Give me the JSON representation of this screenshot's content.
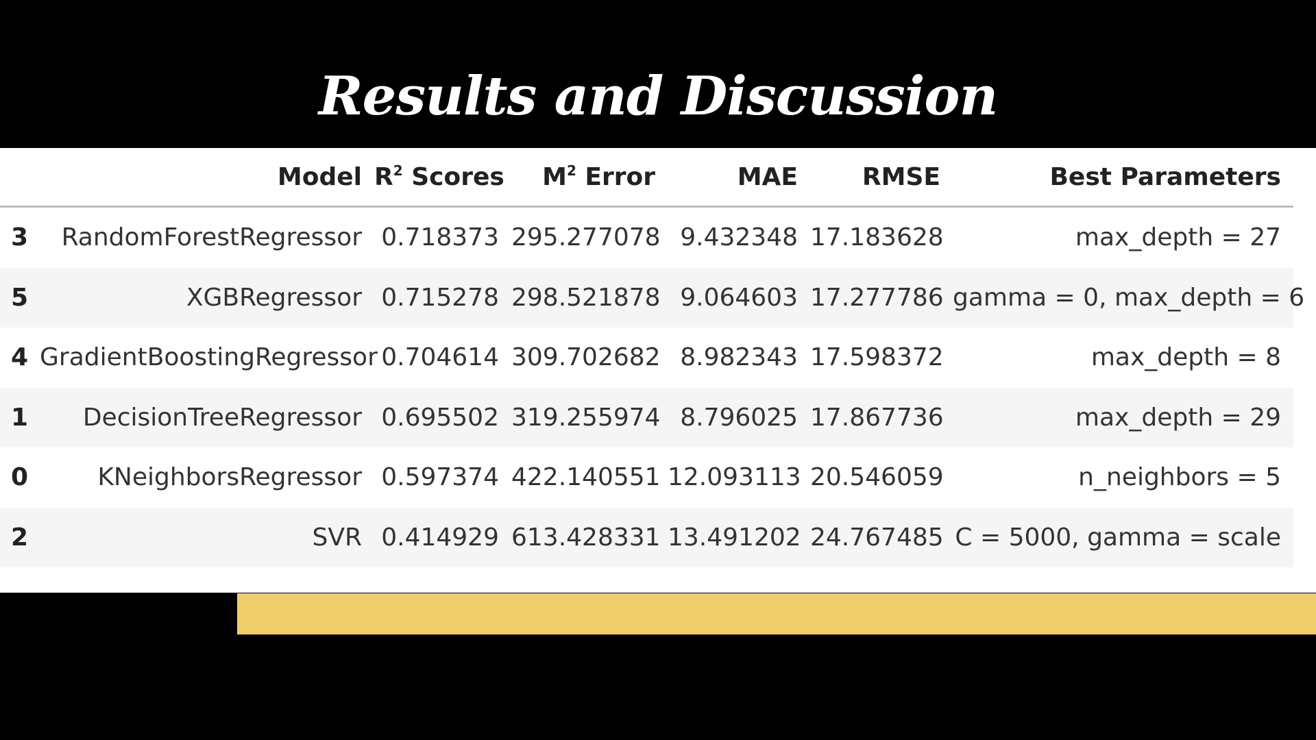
{
  "title": "Results and Discussion",
  "colors": {
    "background": "#000000",
    "accent_bar": "#f0cd6b",
    "table_background": "#ffffff",
    "striped_row": "#f5f5f5"
  },
  "table": {
    "headers": {
      "index": "",
      "model": "Model",
      "r2_base": "R",
      "r2_sup": "2",
      "r2_rest": " Scores",
      "m2_base": "M",
      "m2_sup": "2",
      "m2_rest": " Error",
      "mae": "MAE",
      "rmse": "RMSE",
      "params": "Best Parameters"
    },
    "rows": [
      {
        "index": "3",
        "model": "RandomForestRegressor",
        "r2": "0.718373",
        "mse": "295.277078",
        "mae": "9.432348",
        "rmse": "17.183628",
        "params": "max_depth = 27"
      },
      {
        "index": "5",
        "model": "XGBRegressor",
        "r2": "0.715278",
        "mse": "298.521878",
        "mae": "9.064603",
        "rmse": "17.277786",
        "params": "gamma = 0, max_depth = 6"
      },
      {
        "index": "4",
        "model": "GradientBoostingRegressor",
        "r2": "0.704614",
        "mse": "309.702682",
        "mae": "8.982343",
        "rmse": "17.598372",
        "params": "max_depth = 8"
      },
      {
        "index": "1",
        "model": "DecisionTreeRegressor",
        "r2": "0.695502",
        "mse": "319.255974",
        "mae": "8.796025",
        "rmse": "17.867736",
        "params": "max_depth = 29"
      },
      {
        "index": "0",
        "model": "KNeighborsRegressor",
        "r2": "0.597374",
        "mse": "422.140551",
        "mae": "12.093113",
        "rmse": "20.546059",
        "params": "n_neighbors = 5"
      },
      {
        "index": "2",
        "model": "SVR",
        "r2": "0.414929",
        "mse": "613.428331",
        "mae": "13.491202",
        "rmse": "24.767485",
        "params": "C = 5000, gamma = scale"
      }
    ]
  }
}
